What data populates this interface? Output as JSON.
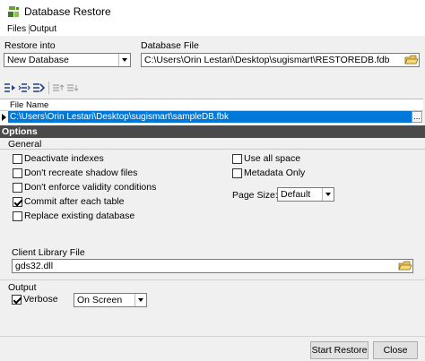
{
  "window": {
    "title": "Database Restore"
  },
  "tabs": [
    {
      "label": "Files"
    },
    {
      "label": "Output"
    }
  ],
  "restore_into": {
    "label": "Restore into",
    "value": "New Database"
  },
  "database_file": {
    "label": "Database File",
    "value": "C:\\Users\\Orin Lestari\\Desktop\\sugismart\\RESTOREDB.fdb"
  },
  "backup_files": {
    "column_header": "File Name",
    "rows": [
      {
        "file_name": "C:\\Users\\Orin Lestari\\Desktop\\sugismart\\sampleDB.fbk"
      }
    ],
    "ellipsis": "..."
  },
  "options": {
    "section_label": "Options",
    "general_label": "General",
    "checkboxes": [
      {
        "label": "Deactivate indexes",
        "checked": false
      },
      {
        "label": "Don't recreate shadow files",
        "checked": false
      },
      {
        "label": "Don't enforce validity conditions",
        "checked": false
      },
      {
        "label": "Commit after each table",
        "checked": true
      },
      {
        "label": "Replace existing database",
        "checked": false
      },
      {
        "label": "Use all space",
        "checked": false
      },
      {
        "label": "Metadata Only",
        "checked": false
      }
    ],
    "page_size": {
      "label": "Page Size:",
      "value": "Default"
    },
    "client_library": {
      "label": "Client Library File",
      "value": "gds32.dll"
    },
    "output": {
      "label": "Output",
      "verbose_label": "Verbose",
      "verbose_checked": true,
      "target": "On Screen"
    }
  },
  "buttons": {
    "start_restore": "Start Restore",
    "close": "Close"
  },
  "icons": [
    "app-db-icon",
    "folder-open-icon",
    "add-file-icon",
    "remove-file-icon",
    "move-file-icon",
    "move-up-icon",
    "move-down-icon",
    "row-pointer-icon"
  ]
}
